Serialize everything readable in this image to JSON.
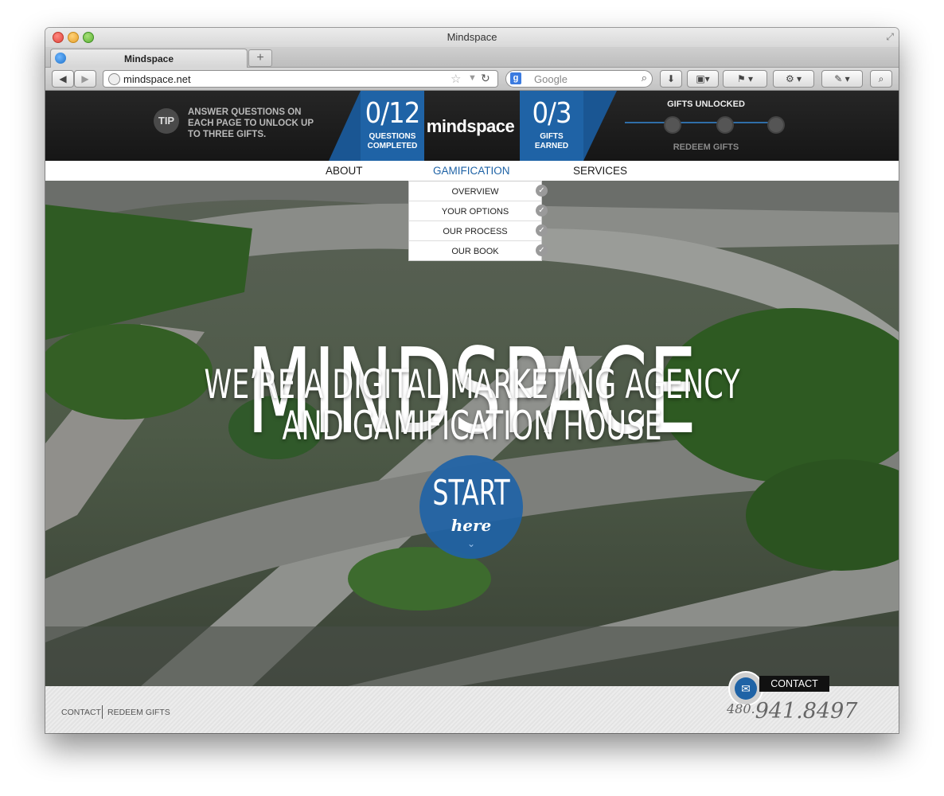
{
  "window": {
    "title": "Mindspace"
  },
  "tabs": [
    {
      "label": "Mindspace"
    }
  ],
  "toolbar": {
    "url": "mindspace.net",
    "search_placeholder": "Google"
  },
  "site": {
    "tip": {
      "badge": "TIP",
      "text": "ANSWER QUESTIONS ON\nEACH PAGE TO UNLOCK UP\nTO THREE GIFTS."
    },
    "questions": {
      "count": "0/12",
      "label": "QUESTIONS\nCOMPLETED"
    },
    "logo": "mindspace",
    "gifts": {
      "count": "0/3",
      "label": "GIFTS\nEARNED"
    },
    "gifts_unlocked_title": "GIFTS UNLOCKED",
    "redeem_gifts": "REDEEM GIFTS",
    "nav": [
      "ABOUT",
      "GAMIFICATION",
      "SERVICES"
    ],
    "dropdown": [
      "OVERVIEW",
      "YOUR OPTIONS",
      "OUR PROCESS",
      "OUR BOOK"
    ],
    "hero_title": "MINDSPACE",
    "hero_sub_1": "WE’RE A DIGITAL MARKETING AGENCY",
    "hero_sub_2": "AND GAMIFICATION HOUSE",
    "start_1": "START",
    "start_2": "here",
    "footer": {
      "contact_link": "CONTACT",
      "redeem_link": "REDEEM GIFTS",
      "contact_tab": "CONTACT",
      "phone_prefix": "480.",
      "phone_number": "941.8497"
    },
    "colors": {
      "accent": "#1f63a6",
      "header_bg": "#1c1c1c"
    }
  }
}
